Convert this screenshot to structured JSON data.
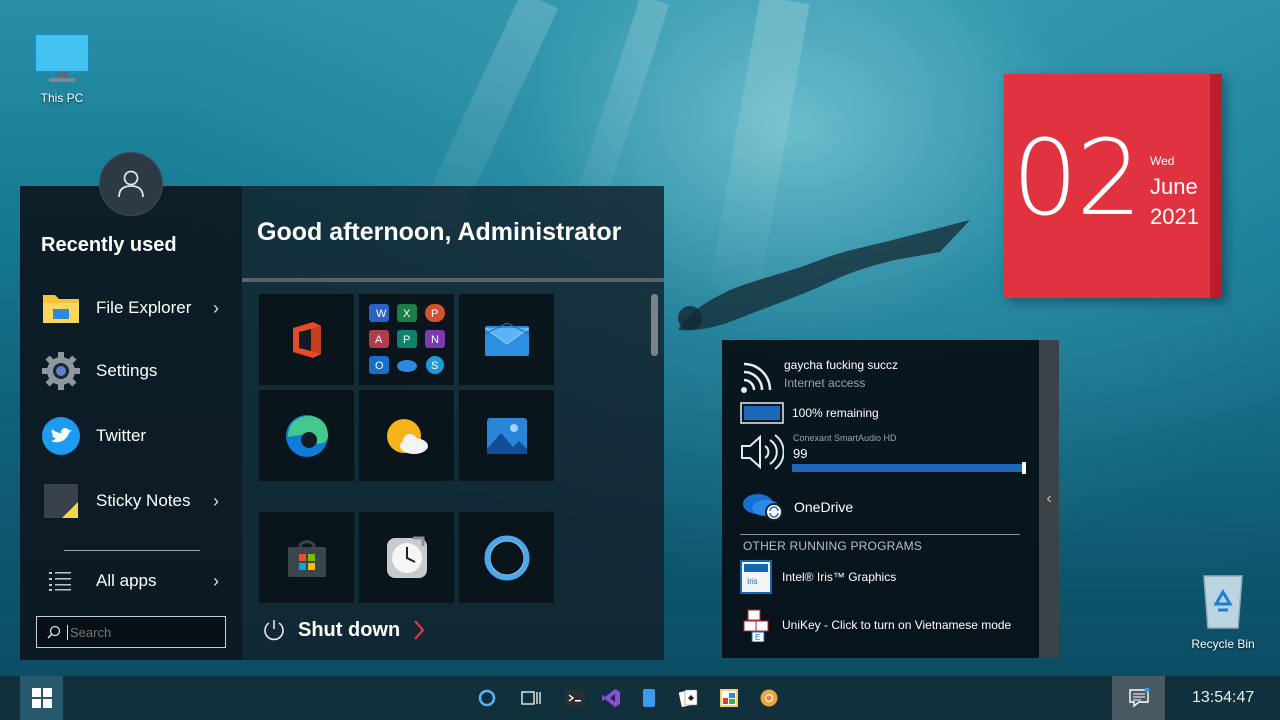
{
  "desktop": {
    "this_pc_label": "This PC",
    "recycle_bin_label": "Recycle Bin"
  },
  "start_menu": {
    "recent_title": "Recently used",
    "recent_items": [
      {
        "label": "File Explorer",
        "icon": "file-explorer-icon",
        "has_submenu": true
      },
      {
        "label": "Settings",
        "icon": "settings-gear-icon",
        "has_submenu": false
      },
      {
        "label": "Twitter",
        "icon": "twitter-icon",
        "has_submenu": false
      },
      {
        "label": "Sticky Notes",
        "icon": "sticky-notes-icon",
        "has_submenu": true
      }
    ],
    "all_apps_label": "All apps",
    "search_placeholder": "Search",
    "greeting": "Good afternoon, Administrator",
    "tiles": [
      {
        "name": "office",
        "icon": "office-icon"
      },
      {
        "name": "office-apps",
        "icon": "office-apps-grid-icon"
      },
      {
        "name": "mail",
        "icon": "mail-icon"
      },
      {
        "name": "edge",
        "icon": "edge-icon"
      },
      {
        "name": "weather",
        "icon": "weather-icon"
      },
      {
        "name": "photos",
        "icon": "photos-icon"
      },
      {
        "name": "store",
        "icon": "store-icon"
      },
      {
        "name": "alarms",
        "icon": "alarm-clock-icon"
      },
      {
        "name": "cortana",
        "icon": "cortana-icon"
      }
    ],
    "shutdown_label": "Shut down"
  },
  "calendar": {
    "day": "02",
    "weekday": "Wed",
    "month": "June",
    "year": "2021"
  },
  "system_panel": {
    "wifi_name": "gaycha fucking succz",
    "wifi_status": "Internet access",
    "battery_text": "100% remaining",
    "battery_level": 1.0,
    "audio_device": "Conexant SmartAudio HD",
    "volume_value": "99",
    "volume_level": 0.99,
    "onedrive_label": "OneDrive",
    "other_programs_title": "OTHER RUNNING PROGRAMS",
    "programs": [
      {
        "label": "Intel® Iris™ Graphics",
        "icon": "intel-graphics-icon"
      },
      {
        "label": "UniKey - Click to turn on Vietnamese mode",
        "icon": "unikey-icon"
      }
    ]
  },
  "taskbar": {
    "icons": [
      "cortana-icon",
      "task-view-icon",
      "terminal-icon",
      "visual-studio-icon",
      "phone-icon",
      "solitaire-icon",
      "paint-icon",
      "chrome-canary-icon"
    ],
    "clock": "13:54:47"
  },
  "colors": {
    "calendar_red": "#e0333f",
    "accent_blue": "#1d66b9"
  }
}
